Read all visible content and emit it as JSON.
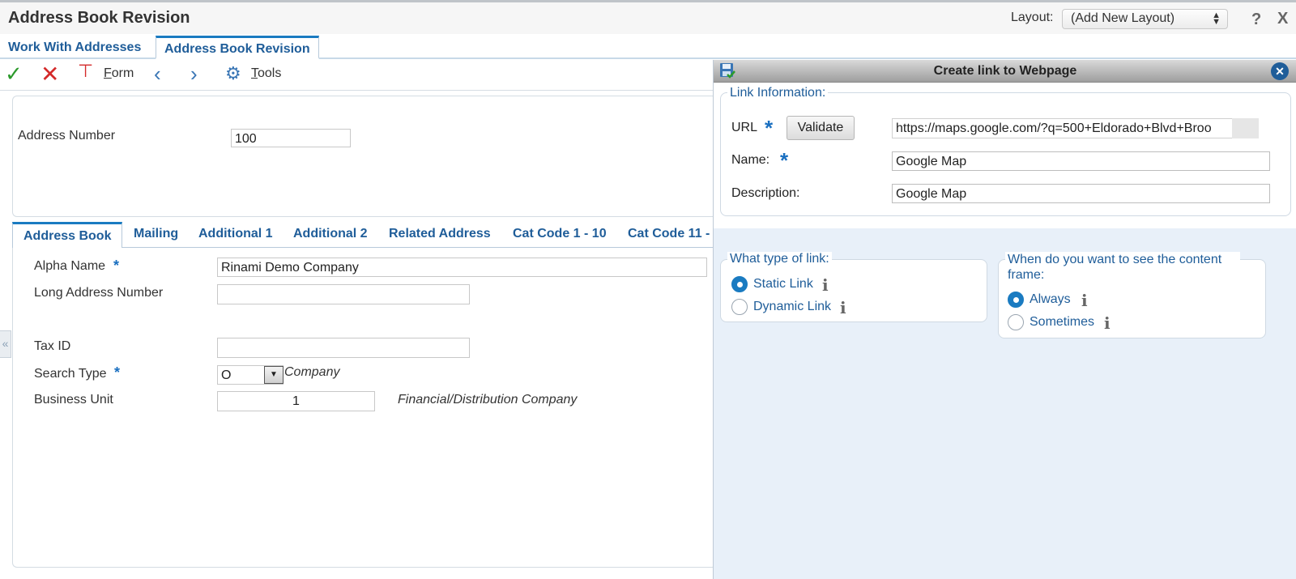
{
  "window": {
    "title": "Address Book Revision",
    "layout_label": "Layout:",
    "layout_value": "(Add New Layout)",
    "help_icon": "?",
    "close_icon": "X"
  },
  "top_tabs": [
    "Work With Addresses",
    "Address Book Revision"
  ],
  "toolbar": {
    "ok_icon": "check-icon",
    "cancel_icon": "close-icon",
    "form_label_first": "F",
    "form_label_rest": "orm",
    "tools_label_first": "T",
    "tools_label_rest": "ools"
  },
  "header": {
    "address_number_label": "Address Number",
    "address_number_value": "100"
  },
  "form_tabs": [
    "Address Book",
    "Mailing",
    "Additional 1",
    "Additional 2",
    "Related Address",
    "Cat Code 1 - 10",
    "Cat Code 11 -"
  ],
  "fields": {
    "alpha_name_label": "Alpha Name",
    "alpha_name_value": "Rinami Demo Company",
    "long_address_label": "Long Address Number",
    "long_address_value": "",
    "tax_id_label": "Tax ID",
    "tax_id_value": "",
    "search_type_label": "Search Type",
    "search_type_value": "O",
    "search_type_desc": "Company",
    "business_unit_label": "Business Unit",
    "business_unit_value": "1",
    "business_unit_desc": "Financial/Distribution Company",
    "required_marker": "*"
  },
  "dialog": {
    "title": "Create link to Webpage",
    "link_info_legend": "Link Information:",
    "url_label": "URL",
    "validate_label": "Validate",
    "url_value": "https://maps.google.com/?q=500+Eldorado+Blvd+Broo",
    "name_label": "Name:",
    "name_value": "Google Map",
    "description_label": "Description:",
    "description_value": "Google Map",
    "link_type_legend": "What type of link:",
    "static_link_label": "Static Link",
    "dynamic_link_label": "Dynamic Link",
    "content_frame_legend": "When do you want to see the content frame:",
    "always_label": "Always",
    "sometimes_label": "Sometimes",
    "info_glyph": "i",
    "selected_link_type": "Static Link",
    "selected_content_frame": "Always"
  },
  "colors": {
    "accent": "#1a7bc1",
    "link_text": "#1f5d99",
    "ok_green": "#2c9a2c",
    "cancel_red": "#d42a2a",
    "dialog_bg": "#e8f0f9"
  }
}
